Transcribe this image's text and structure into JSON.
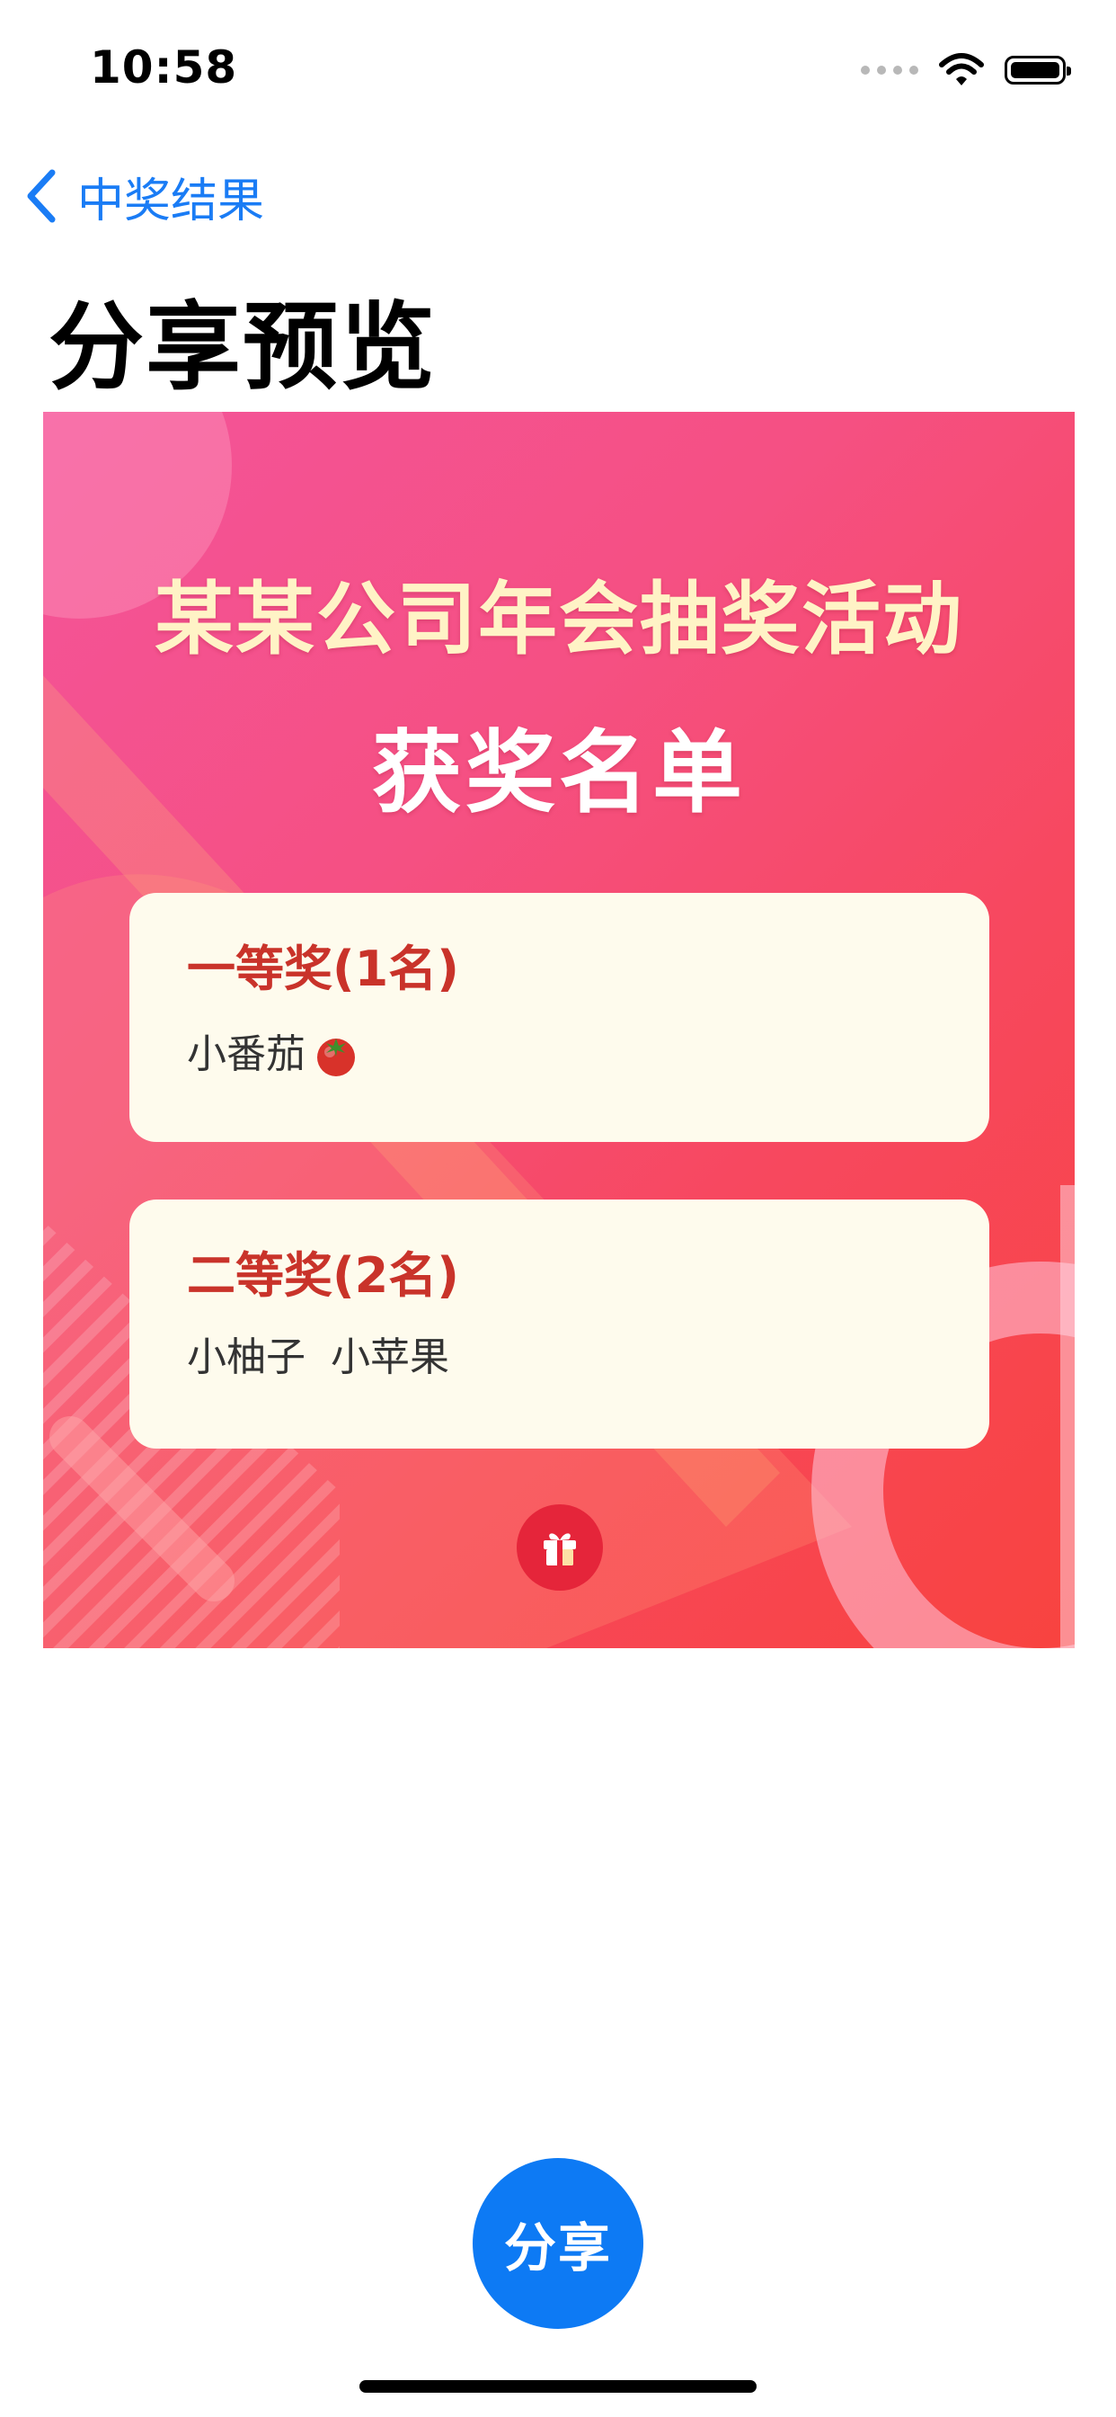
{
  "status_bar": {
    "time": "10:58",
    "signal_icon": "signal-dots-icon",
    "wifi_icon": "wifi-icon",
    "battery_icon": "battery-icon"
  },
  "nav": {
    "back_icon": "chevron-left-icon",
    "back_label": "中奖结果",
    "title": "分享预览"
  },
  "poster": {
    "title": "某某公司年会抽奖活动",
    "subtitle": "获奖名单",
    "prizes": [
      {
        "name": "一等奖(1名)",
        "winners": "小番茄",
        "winner_icon": "tomato-icon"
      },
      {
        "name": "二等奖(2名)",
        "winners": "小柚子  小苹果"
      }
    ],
    "badge_icon": "gift-icon"
  },
  "share_button": {
    "label": "分享"
  },
  "colors": {
    "accent": "#0d7af4",
    "nav_tint": "#1a7cf5",
    "poster_gradient_start": "#f4549a",
    "poster_gradient_end": "#f8433f",
    "card_background": "#fefbed",
    "prize_name": "#c9332a",
    "poster_title": "#fff3c6"
  }
}
